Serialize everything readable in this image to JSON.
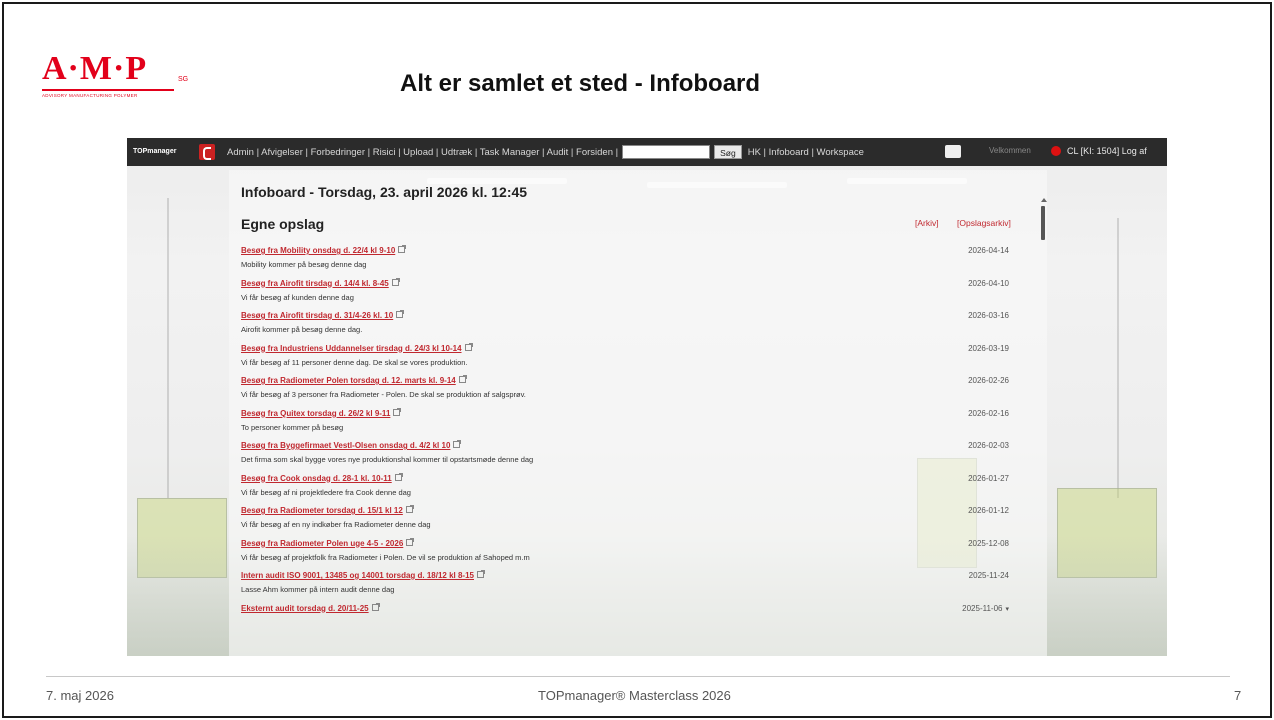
{
  "logo": {
    "mark": "A·M·P",
    "reg": "SG",
    "tagline": "ADVISORY MANUFACTURING POLYMER"
  },
  "slide": {
    "title": "Alt er samlet et sted - Infoboard"
  },
  "navbar": {
    "brand": "TOPmanager",
    "menu": "Admin | Afvigelser | Forbedringer | Risici | Upload | Udtræk | Task Manager | Audit | Forsiden |",
    "search_button": "Søg",
    "menu2": "HK | Infoboard | Workspace",
    "user_label": "Velkommen",
    "user": "CL [KI: 1504]  Log af"
  },
  "board": {
    "title": "Infoboard - Torsdag, 23. april 2026 kl. 12:45",
    "section_title": "Egne opslag",
    "link_arkiv": "[Arkiv]",
    "link_opslag": "[Opslagsarkiv]"
  },
  "posts": [
    {
      "title": "Besøg fra Mobility onsdag d. 22/4 kl 9-10",
      "text": "Mobility kommer på besøg denne dag",
      "date": "2026-04-14"
    },
    {
      "title": "Besøg fra Airofit tirsdag d. 14/4 kl. 8-45",
      "text": "Vi får besøg af kunden denne dag",
      "date": "2026-04-10"
    },
    {
      "title": "Besøg fra Airofit tirsdag d. 31/4-26 kl. 10",
      "text": "Airofit kommer på besøg denne dag.",
      "date": "2026-03-16"
    },
    {
      "title": "Besøg fra Industriens Uddannelser tirsdag d. 24/3 kl 10-14",
      "text": "Vi får besøg af 11 personer denne dag. De skal se vores produktion.",
      "date": "2026-03-19"
    },
    {
      "title": "Besøg fra Radiometer Polen torsdag d. 12. marts kl. 9-14",
      "text": "Vi får besøg af 3 personer fra Radiometer - Polen. De skal se produktion af salgsprøv.",
      "date": "2026-02-26"
    },
    {
      "title": "Besøg fra Quitex torsdag d. 26/2 kl 9-11",
      "text": "To personer kommer på besøg",
      "date": "2026-02-16"
    },
    {
      "title": "Besøg fra Byggefirmaet Vestl-Olsen onsdag d. 4/2 kl 10",
      "text": "Det firma som skal bygge vores nye produktionshal kommer til opstartsmøde denne dag",
      "date": "2026-02-03"
    },
    {
      "title": "Besøg fra Cook onsdag d. 28-1 kl. 10-11",
      "text": "Vi får besøg af ni projektledere fra Cook denne dag",
      "date": "2026-01-27"
    },
    {
      "title": "Besøg fra Radiometer torsdag d. 15/1 kl 12",
      "text": "Vi får besøg af en ny indkøber fra Radiometer denne dag",
      "date": "2026-01-12"
    },
    {
      "title": "Besøg fra Radiometer Polen uge 4-5 - 2026",
      "text": "Vi får besøg af projektfolk fra Radiometer i Polen. De vil se produktion af Sahoped m.m",
      "date": "2025-12-08"
    },
    {
      "title": "Intern audit ISO 9001, 13485 og 14001 torsdag d. 18/12 kl 8-15",
      "text": "Lasse Ahm kommer på intern audit denne dag",
      "date": "2025-11-24"
    },
    {
      "title": "Eksternt audit torsdag d. 20/11-25",
      "text": "",
      "date": "2025-11-06",
      "more": "▾"
    }
  ],
  "footer": {
    "date": "7. maj 2026",
    "center": "TOPmanager® Masterclass 2026",
    "page": "7"
  },
  "colors": {
    "brand_red": "#e2001a",
    "link_red": "#c0282f",
    "navbar": "#2b2b2b"
  }
}
